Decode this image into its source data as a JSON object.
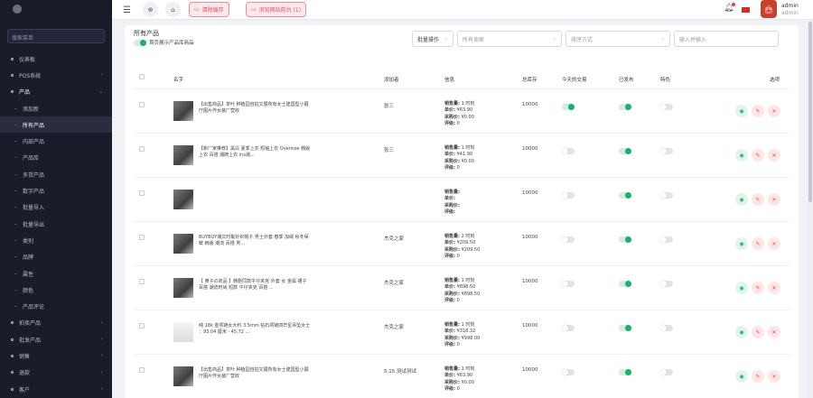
{
  "sidebar": {
    "search_placeholder": "搜索菜单",
    "items": [
      {
        "label": "仪表板",
        "icon": "grid-icon",
        "type": "top"
      },
      {
        "label": "POS系统",
        "icon": "pos-icon",
        "type": "top",
        "caret": "›"
      },
      {
        "label": "产品",
        "icon": "box-icon",
        "type": "open",
        "caret": "⌄"
      },
      {
        "label": "添加新",
        "type": "sub"
      },
      {
        "label": "所有产品",
        "type": "sub",
        "active": true
      },
      {
        "label": "内部产品",
        "type": "sub"
      },
      {
        "label": "产品库",
        "type": "sub"
      },
      {
        "label": "多货产品",
        "type": "sub"
      },
      {
        "label": "数字产品",
        "type": "sub"
      },
      {
        "label": "批量导入",
        "type": "sub"
      },
      {
        "label": "批量导出",
        "type": "sub"
      },
      {
        "label": "类别",
        "type": "sub"
      },
      {
        "label": "品牌",
        "type": "sub"
      },
      {
        "label": "属性",
        "type": "sub"
      },
      {
        "label": "颜色",
        "type": "sub"
      },
      {
        "label": "产品评论",
        "type": "sub"
      },
      {
        "label": "拍卖产品",
        "icon": "gavel-icon",
        "type": "top",
        "caret": "›"
      },
      {
        "label": "批发产品",
        "icon": "stack-icon",
        "type": "top",
        "caret": "›"
      },
      {
        "label": "销售",
        "icon": "cart-icon",
        "type": "top",
        "caret": "›"
      },
      {
        "label": "退款",
        "icon": "refund-icon",
        "type": "top",
        "caret": "›"
      },
      {
        "label": "客户",
        "icon": "user-icon",
        "type": "top",
        "caret": "›"
      }
    ]
  },
  "topbar": {
    "btn1": "清除缓存",
    "btn2": "浏览网站前台 (1)",
    "user_name": "admin",
    "user_role": "admin"
  },
  "page": {
    "title": "所有产品",
    "toggle_hint": "首页展示产品库商品"
  },
  "filters": {
    "bulk": "批量操作",
    "seller": "所有卖家",
    "sort": "排序方式",
    "search_placeholder": "输入并输入"
  },
  "columns": {
    "name": "名字",
    "added_by": "添加者",
    "info": "信息",
    "stock": "总库存",
    "todays_deal": "今天的交易",
    "published": "已发布",
    "featured": "特色",
    "options": "选项"
  },
  "sales_labels": {
    "num": "销售量:",
    "price": "单价:",
    "purchase": "采购价:",
    "rating": "评级:"
  },
  "rows": [
    {
      "name": "【出售商品】茶叶 种植园自拍又展所有女士建国型小展厅图片作女装厂营收",
      "shop": "张三",
      "num": "1 时刻",
      "price": "¥63.90",
      "purchase": "¥0.00",
      "rating": "0",
      "stock": "10000",
      "today": true,
      "published": true,
      "featured": false,
      "thumb": "dark"
    },
    {
      "name": "【新厂家推荐】黑白 夏季上衣 短袖上衣 Oversize 韩版上衣 百搭 潮牌上衣 ins潮...",
      "shop": "张三",
      "num": "1 时刻",
      "price": "¥41.90",
      "purchase": "¥0.00",
      "rating": "0",
      "stock": "10000",
      "today": false,
      "published": true,
      "featured": false,
      "thumb": "dark"
    },
    {
      "name": "",
      "shop": "",
      "num": "",
      "price": "",
      "purchase": "",
      "rating": "",
      "stock": "10000",
      "today": false,
      "published": true,
      "featured": false,
      "thumb": "dark"
    },
    {
      "name": "BUYBUY潮又时髦针织帽子 男士外套 春季 加绒 秋冬保暖 韩版 潮流 百搭 男...",
      "shop": "杰克之家",
      "num": "2 时刻",
      "price": "¥209.50",
      "purchase": "¥209.50",
      "rating": "0",
      "stock": "10000",
      "today": false,
      "published": true,
      "featured": false,
      "thumb": "dark"
    },
    {
      "name": "【 黄子の商品 】韩剧同款牛仔夹克 外套 女 金属 裙子 百搭 潮流时尚 短款 牛仔夹克 百搭 ...",
      "shop": "杰克之家",
      "num": "1 时刻",
      "price": "¥898.50",
      "purchase": "¥898.50",
      "rating": "0",
      "stock": "10000",
      "today": false,
      "published": true,
      "featured": false,
      "thumb": "dark"
    },
    {
      "name": "纯 18k 金项链女大料 3.5mm 钻石项链四芒星吊坠女士 ：93.04 厘米 · 45.72 ...",
      "shop": "杰克之家",
      "num": "1 时刻",
      "price": "¥318.32",
      "purchase": "¥998.00",
      "rating": "0",
      "stock": "10000",
      "today": false,
      "published": true,
      "featured": false,
      "thumb": "light"
    },
    {
      "name": "【出售商品】茶叶 种植园自拍又展所有女士建国型小展厅图片作女装厂营收",
      "shop": "5.15 测试测试",
      "num": "1 时刻",
      "price": "¥63.90",
      "purchase": "¥0.00",
      "rating": "0",
      "stock": "10000",
      "today": false,
      "published": true,
      "featured": false,
      "thumb": "dark"
    }
  ],
  "colors": {
    "accent_green": "#17b26a",
    "danger_red": "#e55050",
    "sidebar_bg": "#1b1c2a"
  }
}
